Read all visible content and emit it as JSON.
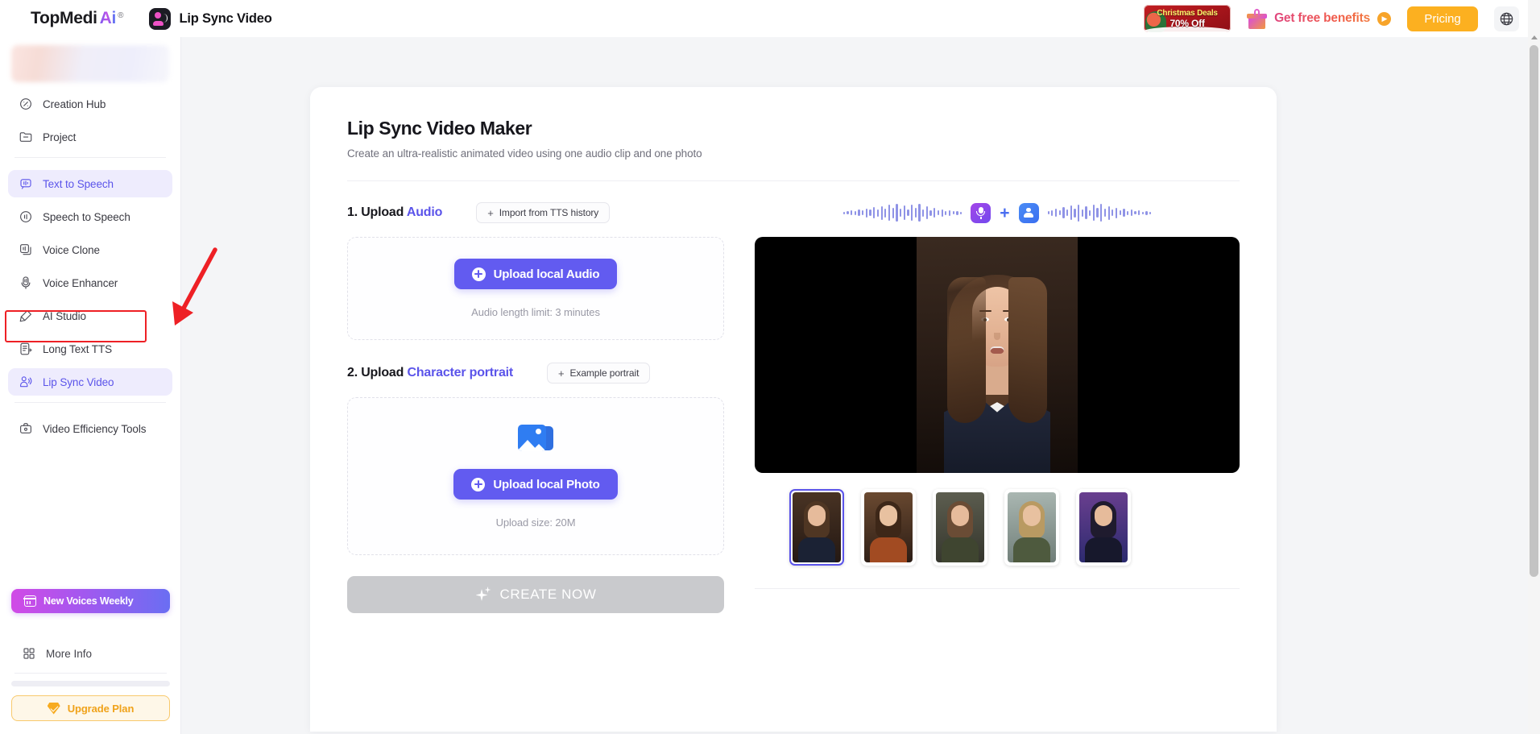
{
  "header": {
    "brand_main": "TopMedi",
    "brand_ai": "Ai",
    "brand_reg": "®",
    "app_title": "Lip Sync Video",
    "xmas_line1": "Christmas Deals",
    "xmas_line2": "70% Off",
    "benefits_label": "Get free benefits",
    "benefits_arrow": "▶",
    "pricing_label": "Pricing",
    "globe_icon": "globe-icon"
  },
  "sidebar": {
    "items_top": [
      {
        "label": "Creation Hub",
        "icon": "creation-hub-icon",
        "active": false
      },
      {
        "label": "Project",
        "icon": "folder-icon",
        "active": false
      }
    ],
    "items_main": [
      {
        "label": "Text to Speech",
        "icon": "text-to-speech-icon",
        "active": true
      },
      {
        "label": "Speech to Speech",
        "icon": "speech-to-speech-icon",
        "active": false
      },
      {
        "label": "Voice Clone",
        "icon": "voice-clone-icon",
        "active": false
      },
      {
        "label": "Voice Enhancer",
        "icon": "voice-enhancer-icon",
        "active": false
      },
      {
        "label": "AI Studio",
        "icon": "ai-studio-icon",
        "active": false
      },
      {
        "label": "Long Text TTS",
        "icon": "long-text-tts-icon",
        "active": false
      },
      {
        "label": "Lip Sync Video",
        "icon": "lip-sync-video-icon",
        "active": true
      }
    ],
    "items_after": [
      {
        "label": "Video Efficiency Tools",
        "icon": "video-tools-icon",
        "active": false
      }
    ],
    "new_voices_label": "New Voices Weekly",
    "more_info_label": "More Info",
    "upgrade_label": "Upgrade Plan"
  },
  "main": {
    "title": "Lip Sync Video Maker",
    "subtitle": "Create an ultra-realistic animated video using one audio clip and one photo",
    "step1": {
      "number": "1. Upload ",
      "highlight": "Audio",
      "action_label": "Import from TTS history",
      "action_plus": "+",
      "upload_label": "Upload local Audio",
      "hint": "Audio length limit: 3 minutes"
    },
    "step2": {
      "number": "2. Upload ",
      "highlight": "Character portrait",
      "action_label": "Example portrait",
      "action_plus": "+",
      "upload_label": "Upload local Photo",
      "hint": "Upload size: 20M"
    },
    "create_label": "CREATE NOW",
    "create_disabled": true
  },
  "preview": {
    "plus_symbol": "+",
    "mic_icon": "microphone-icon",
    "person_icon": "person-icon",
    "thumbnails": [
      {
        "name": "portrait-businesswoman",
        "selected": true
      },
      {
        "name": "portrait-man-brown-coat",
        "selected": false
      },
      {
        "name": "portrait-woman-long-hair",
        "selected": false
      },
      {
        "name": "portrait-blond-man",
        "selected": false
      },
      {
        "name": "portrait-cyberpunk-woman",
        "selected": false
      }
    ]
  },
  "colors": {
    "accent_purple": "#625bf0",
    "accent_link": "#5b54ea",
    "pricing_yellow": "#fcb020",
    "upgrade_orange": "#f0a219",
    "annotation_red": "#ee2025",
    "disabled_gray": "#c9cacd"
  },
  "annotations": {
    "highlight_target": "sidebar-item-lip-sync-video",
    "arrow_icon": "red-arrow-icon",
    "box_icon": "red-highlight-box"
  }
}
